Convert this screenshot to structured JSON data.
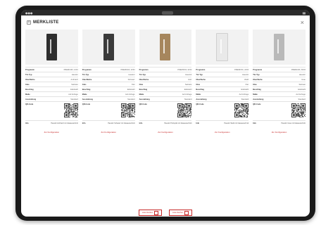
{
  "modal": {
    "title": "MERKLISTE"
  },
  "colors": {
    "accent": "#c62828",
    "door_colors": [
      "#2e2e2e",
      "#3a3a3a",
      "#a6865d",
      "#e9e9e9",
      "#b9b9b9"
    ]
  },
  "cards": [
    {
      "rows": [
        {
          "label": "Programm",
          "value": "PREMIUM | 1234"
        },
        {
          "label": "Tür-Typ",
          "value": "Haustür"
        },
        {
          "label": "Oberfläche",
          "value": "Anthrazit"
        },
        {
          "label": "Glas",
          "value": "Satinato"
        },
        {
          "label": "Beschlag",
          "value": "Edelstahl"
        },
        {
          "label": "Maße",
          "value": "Auf Anfrage"
        },
        {
          "label": "Ausstattung",
          "value": "Standard"
        }
      ],
      "qr_label": "QR-Code",
      "note_label": "Info",
      "note": "Haustür Anthrazit mit Glasausschnitt",
      "link_text": "Zur Konfiguration"
    },
    {
      "rows": [
        {
          "label": "Programm",
          "value": "PREMIUM | 2234"
        },
        {
          "label": "Tür-Typ",
          "value": "Haustür"
        },
        {
          "label": "Oberfläche",
          "value": "Schwarz"
        },
        {
          "label": "Glas",
          "value": "Klar"
        },
        {
          "label": "Beschlag",
          "value": "Edelstahl"
        },
        {
          "label": "Maße",
          "value": "Auf Anfrage"
        },
        {
          "label": "Ausstattung",
          "value": "Standard"
        }
      ],
      "qr_label": "QR-Code",
      "note_label": "Info",
      "note": "Haustür Schwarz mit Glasausschnitt",
      "link_text": "Zur Konfiguration"
    },
    {
      "rows": [
        {
          "label": "Programm",
          "value": "PREMIUM | 3234"
        },
        {
          "label": "Tür-Typ",
          "value": "Haustür"
        },
        {
          "label": "Oberfläche",
          "value": "Holz"
        },
        {
          "label": "Glas",
          "value": "Satinato"
        },
        {
          "label": "Beschlag",
          "value": "Edelstahl"
        },
        {
          "label": "Maße",
          "value": "Auf Anfrage"
        },
        {
          "label": "Ausstattung",
          "value": "Standard"
        }
      ],
      "qr_label": "QR-Code",
      "note_label": "Info",
      "note": "Haustür Holzoptik mit Glasausschnitt",
      "link_text": "Zur Konfiguration"
    },
    {
      "rows": [
        {
          "label": "Programm",
          "value": "PREMIUM | 4234"
        },
        {
          "label": "Tür-Typ",
          "value": "Haustür"
        },
        {
          "label": "Oberfläche",
          "value": "Weiß"
        },
        {
          "label": "Glas",
          "value": "Klar"
        },
        {
          "label": "Beschlag",
          "value": "Edelstahl"
        },
        {
          "label": "Maße",
          "value": "Auf Anfrage"
        },
        {
          "label": "Ausstattung",
          "value": "Standard"
        }
      ],
      "qr_label": "QR-Code",
      "note_label": "Info",
      "note": "Haustür Weiß mit Glasausschnitt",
      "link_text": "Zur Konfiguration"
    },
    {
      "rows": [
        {
          "label": "Programm",
          "value": "PREMIUM | 5234"
        },
        {
          "label": "Tür-Typ",
          "value": "Haustür"
        },
        {
          "label": "Oberfläche",
          "value": "Grau"
        },
        {
          "label": "Glas",
          "value": "Satinato"
        },
        {
          "label": "Beschlag",
          "value": "Edelstahl"
        },
        {
          "label": "Maße",
          "value": "Auf Anfrage"
        },
        {
          "label": "Ausstattung",
          "value": "Standard"
        }
      ],
      "qr_label": "QR-Code",
      "note_label": "Info",
      "note": "Haustür Grau mit Glasausschnitt",
      "link_text": "Zur Konfiguration"
    }
  ],
  "footer": {
    "print_label": "Liste drucken",
    "delete_label": "Liste löschen"
  }
}
